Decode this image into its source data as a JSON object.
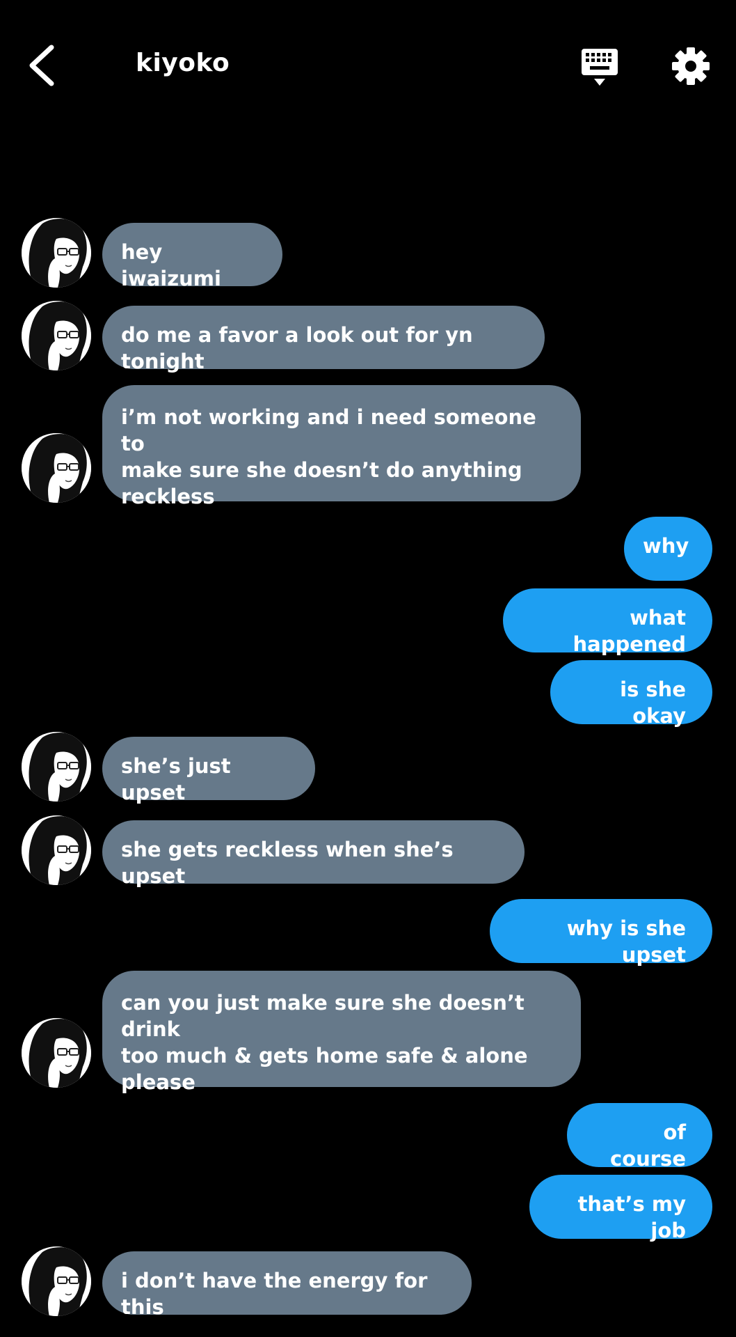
{
  "header": {
    "title": "kiyoko",
    "back_icon": "chevron-left-icon",
    "keyboard_icon": "keyboard-icon",
    "settings_icon": "gear-icon"
  },
  "colors": {
    "background": "#000000",
    "incoming_bubble": "#66798a",
    "outgoing_bubble": "#1e9ff2",
    "text": "#ffffff"
  },
  "messages": [
    {
      "from": "kiyoko",
      "text": "hey iwaizumi"
    },
    {
      "from": "kiyoko",
      "text": "do me a favor a look out for yn tonight"
    },
    {
      "from": "kiyoko",
      "text": "i’m not working and i need someone to\nmake sure she doesn’t do anything\nreckless"
    },
    {
      "from": "me",
      "text": "why"
    },
    {
      "from": "me",
      "text": "what happened"
    },
    {
      "from": "me",
      "text": "is she okay"
    },
    {
      "from": "kiyoko",
      "text": "she’s just upset"
    },
    {
      "from": "kiyoko",
      "text": "she gets reckless when she’s upset"
    },
    {
      "from": "me",
      "text": "why is she upset"
    },
    {
      "from": "kiyoko",
      "text": "can you just make sure she doesn’t drink\ntoo much & gets home safe & alone\nplease"
    },
    {
      "from": "me",
      "text": "of course"
    },
    {
      "from": "me",
      "text": "that’s my job"
    },
    {
      "from": "kiyoko",
      "text": "i don’t have the energy for this"
    }
  ]
}
